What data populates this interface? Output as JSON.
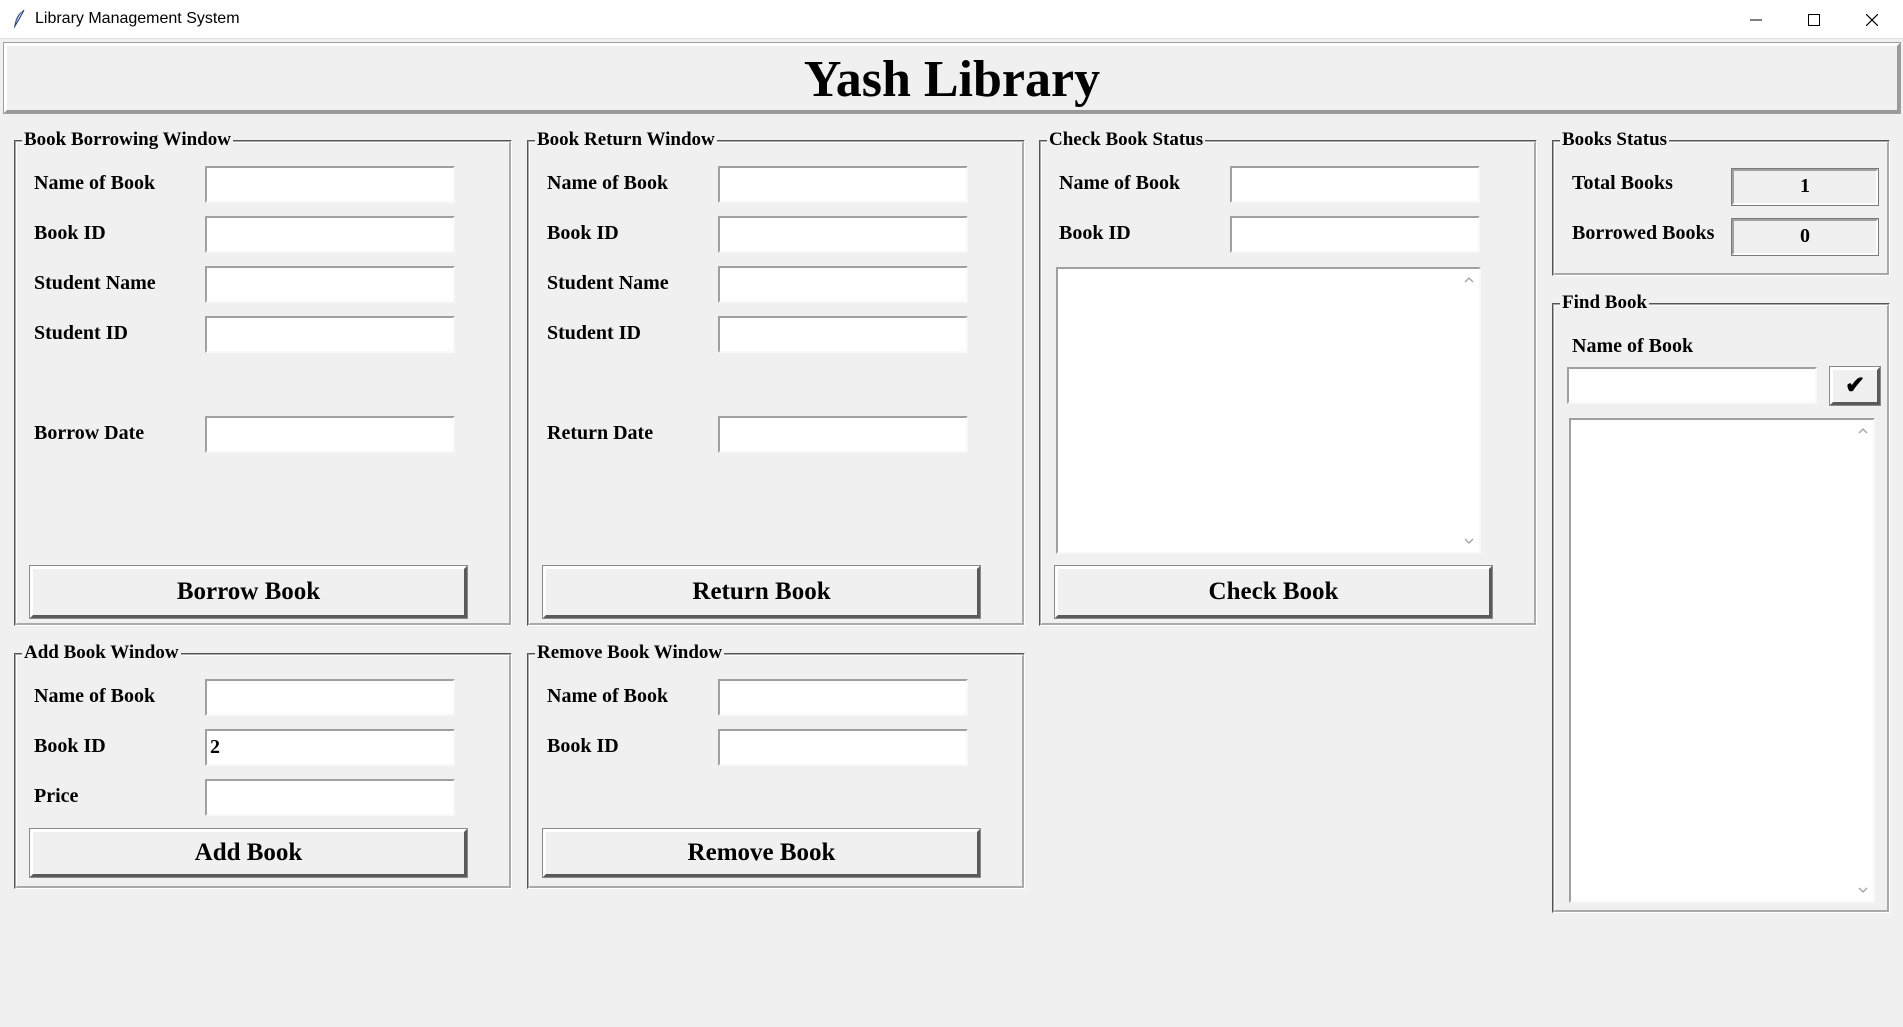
{
  "window": {
    "title": "Library Management System",
    "controls": {
      "minimize": "minimize-icon",
      "maximize": "maximize-icon",
      "close": "close-icon"
    }
  },
  "header": {
    "title": "Yash Library"
  },
  "borrow": {
    "title": "Book Borrowing Window",
    "labels": {
      "book_name": "Name of Book",
      "book_id": "Book ID",
      "student_name": "Student Name",
      "student_id": "Student ID",
      "date": "Borrow Date"
    },
    "values": {
      "book_name": "",
      "book_id": "",
      "student_name": "",
      "student_id": "",
      "date": ""
    },
    "button": "Borrow Book"
  },
  "return": {
    "title": "Book Return Window",
    "labels": {
      "book_name": "Name of Book",
      "book_id": "Book ID",
      "student_name": "Student Name",
      "student_id": "Student ID",
      "date": "Return Date"
    },
    "values": {
      "book_name": "",
      "book_id": "",
      "student_name": "",
      "student_id": "",
      "date": ""
    },
    "button": "Return Book"
  },
  "check": {
    "title": "Check Book Status",
    "labels": {
      "book_name": "Name of Book",
      "book_id": "Book ID"
    },
    "values": {
      "book_name": "",
      "book_id": ""
    },
    "button": "Check Book"
  },
  "add": {
    "title": "Add Book Window",
    "labels": {
      "book_name": "Name of Book",
      "book_id": "Book ID",
      "price": "Price"
    },
    "values": {
      "book_name": "",
      "book_id": "2",
      "price": ""
    },
    "button": "Add Book"
  },
  "remove": {
    "title": "Remove Book Window",
    "labels": {
      "book_name": "Name of Book",
      "book_id": "Book ID"
    },
    "values": {
      "book_name": "",
      "book_id": ""
    },
    "button": "Remove Book"
  },
  "status": {
    "title": "Books Status",
    "total_label": "Total Books",
    "total_value": "1",
    "borrowed_label": "Borrowed Books",
    "borrowed_value": "0"
  },
  "find": {
    "title": "Find Book",
    "label": "Name of Book",
    "value": "",
    "button_glyph": "✔"
  }
}
